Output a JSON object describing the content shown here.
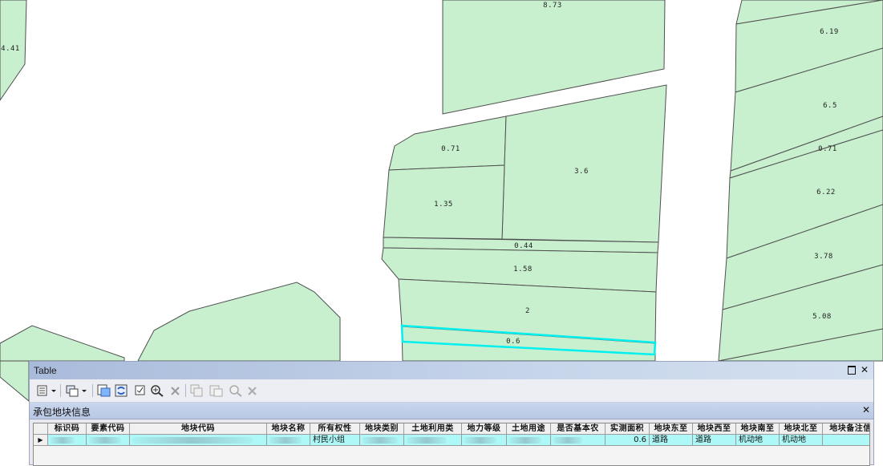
{
  "map": {
    "parcel_fill": "#c8f0cf",
    "parcel_stroke": "#505050",
    "highlight_color": "#00f0f0",
    "labels": {
      "p873": "8.73",
      "p441": "4.41",
      "p071a": "0.71",
      "p36": "3.6",
      "p135": "1.35",
      "p044": "0.44",
      "p158": "1.58",
      "p2": "2",
      "p06": "0.6",
      "p619": "6.19",
      "p65": "6.5",
      "p071b": "0.71",
      "p622": "6.22",
      "p378": "3.78",
      "p508": "5.08"
    }
  },
  "window": {
    "title": "Table",
    "maximize_icon": "maximize-icon",
    "close_label": "✕"
  },
  "tab": {
    "title": "承包地块信息",
    "close_label": "✕"
  },
  "table": {
    "columns": {
      "c1": "标识码",
      "c2": "要素代码",
      "c3": "地块代码",
      "c4": "地块名称",
      "c5": "所有权性",
      "c6": "地块类别",
      "c7": "土地利用类",
      "c8": "地力等级",
      "c9": "土地用途",
      "c10": "是否基本农",
      "c11": "实测面积",
      "c12": "地块东至",
      "c13": "地块西至",
      "c14": "地块南至",
      "c15": "地块北至",
      "c16": "地块备注信"
    },
    "row": {
      "selector": "▶",
      "c5": "村民小组",
      "c11": "0.6",
      "c12": "道路",
      "c13": "道路",
      "c14": "机动地",
      "c15": "机动地"
    }
  }
}
